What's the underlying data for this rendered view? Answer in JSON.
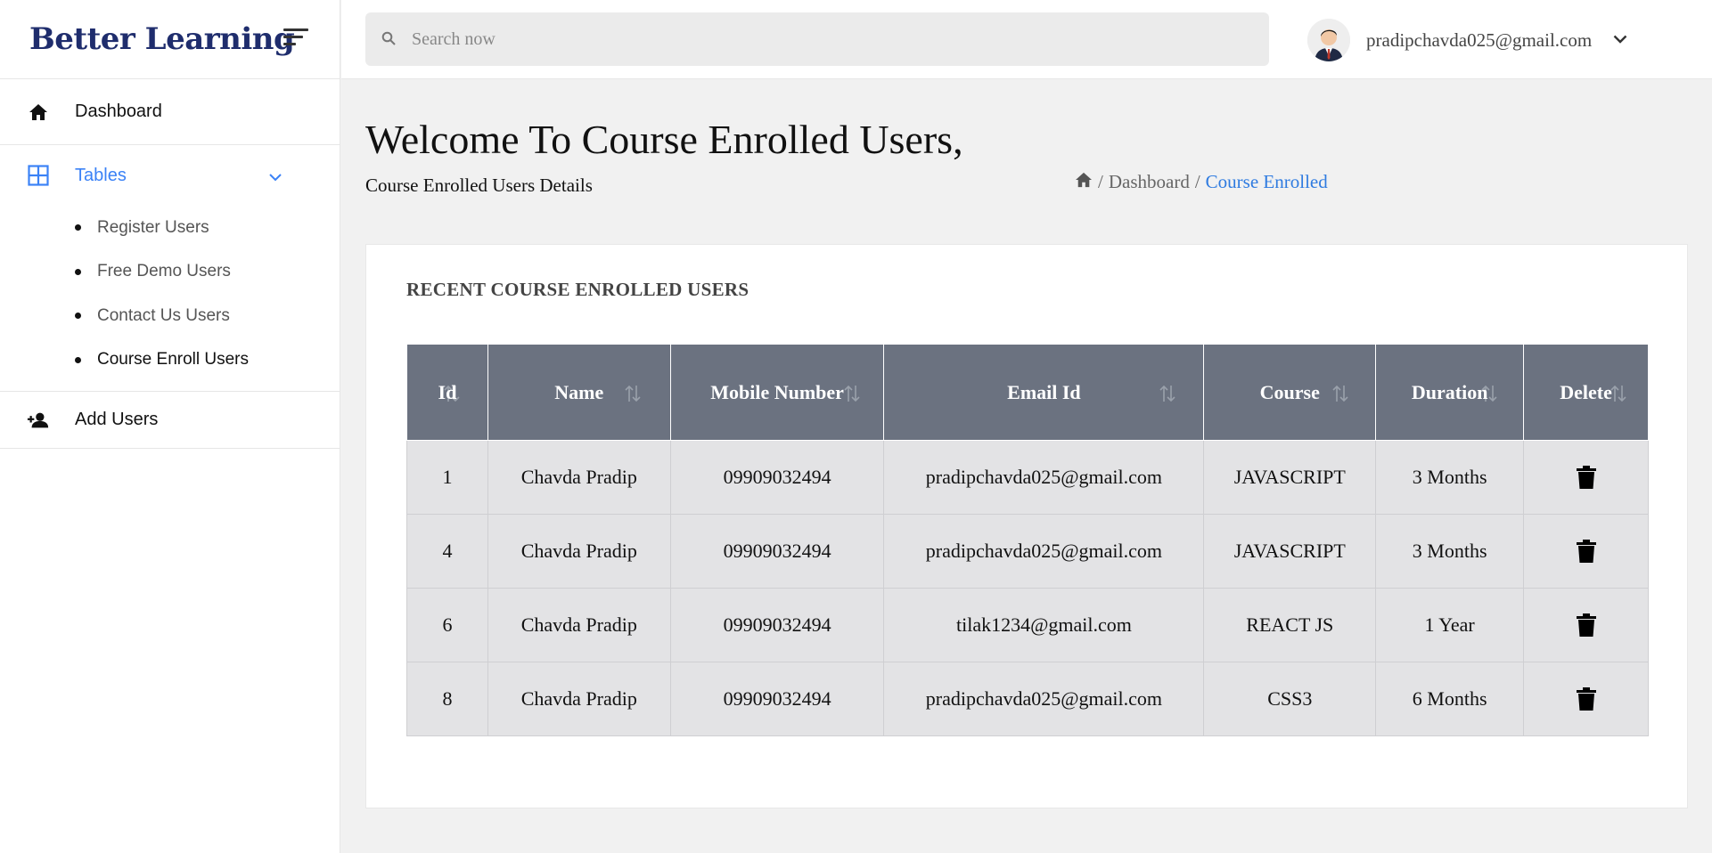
{
  "brand": {
    "name": "Better Learning"
  },
  "sidebar": {
    "dashboard": {
      "label": "Dashboard",
      "icon": "home-icon"
    },
    "tables": {
      "label": "Tables",
      "icon": "grid-icon"
    },
    "sub_items": [
      {
        "label": "Register Users"
      },
      {
        "label": "Free Demo Users"
      },
      {
        "label": "Contact Us Users"
      },
      {
        "label": "Course Enroll Users"
      }
    ],
    "add_users": {
      "label": "Add Users",
      "icon": "person-add-icon"
    }
  },
  "header": {
    "search_placeholder": "Search now",
    "user_email": "pradipchavda025@gmail.com"
  },
  "page": {
    "title": "Welcome To Course Enrolled Users,",
    "subtitle": "Course Enrolled Users Details",
    "breadcrumb": {
      "home_icon": "home-icon",
      "sep": "/",
      "dashboard": "Dashboard",
      "current": "Course Enrolled"
    }
  },
  "card": {
    "title": "RECENT COURSE ENROLLED USERS",
    "columns": [
      "Id",
      "Name",
      "Mobile Number",
      "Email Id",
      "Course",
      "Duration",
      "Delete"
    ],
    "rows": [
      {
        "id": "1",
        "name": "Chavda Pradip",
        "mobile": "09909032494",
        "email": "pradipchavda025@gmail.com",
        "course": "JAVASCRIPT",
        "duration": "3 Months"
      },
      {
        "id": "4",
        "name": "Chavda Pradip",
        "mobile": "09909032494",
        "email": "pradipchavda025@gmail.com",
        "course": "JAVASCRIPT",
        "duration": "3 Months"
      },
      {
        "id": "6",
        "name": "Chavda Pradip",
        "mobile": "09909032494",
        "email": "tilak1234@gmail.com",
        "course": "REACT JS",
        "duration": "1 Year"
      },
      {
        "id": "8",
        "name": "Chavda Pradip",
        "mobile": "09909032494",
        "email": "pradipchavda025@gmail.com",
        "course": "CSS3",
        "duration": "6 Months"
      }
    ]
  },
  "colors": {
    "brand": "#1f2d6d",
    "accent": "#3b82f6",
    "table_header": "#6b7280",
    "row_bg": "#e3e3e5"
  }
}
